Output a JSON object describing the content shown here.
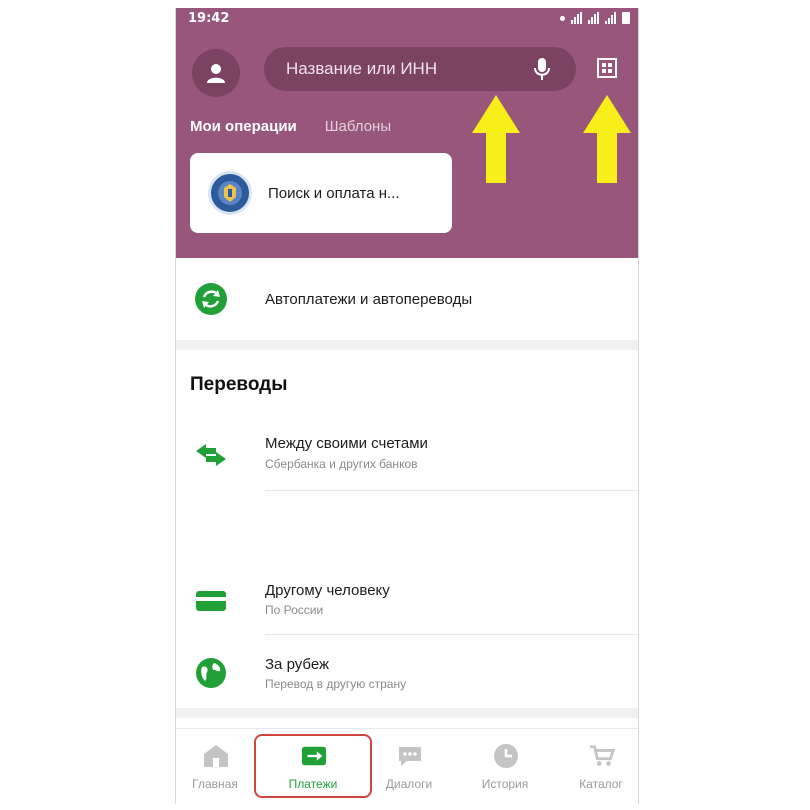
{
  "status": {
    "time": "19:42"
  },
  "search": {
    "placeholder": "Название или ИНН"
  },
  "tabs": [
    {
      "label": "Мои операции"
    },
    {
      "label": "Шаблоны"
    }
  ],
  "fns_card": {
    "label": "Поиск и оплата н..."
  },
  "autopay": {
    "label": "Автоплатежи и автопереводы"
  },
  "transfers": {
    "title": "Переводы",
    "items": [
      {
        "title": "Между своими счетами",
        "subtitle": "Сбербанка и других банков",
        "icon": "exchange-icon"
      },
      {
        "title": "Другому человеку",
        "subtitle": "По России",
        "icon": "card-icon"
      },
      {
        "title": "За рубеж",
        "subtitle": "Перевод в другую страну",
        "icon": "globe-icon"
      }
    ]
  },
  "bottom_nav": [
    {
      "label": "Главная",
      "icon": "home-icon"
    },
    {
      "label": "Платежи",
      "icon": "payments-arrow-icon",
      "active": true
    },
    {
      "label": "Диалоги",
      "icon": "chat-icon"
    },
    {
      "label": "История",
      "icon": "clock-icon"
    },
    {
      "label": "Каталог",
      "icon": "cart-icon"
    }
  ],
  "colors": {
    "header": "#98577a",
    "accent_green": "#21a038",
    "arrow": "#f7ee1a",
    "highlight_border": "#d0463f"
  }
}
